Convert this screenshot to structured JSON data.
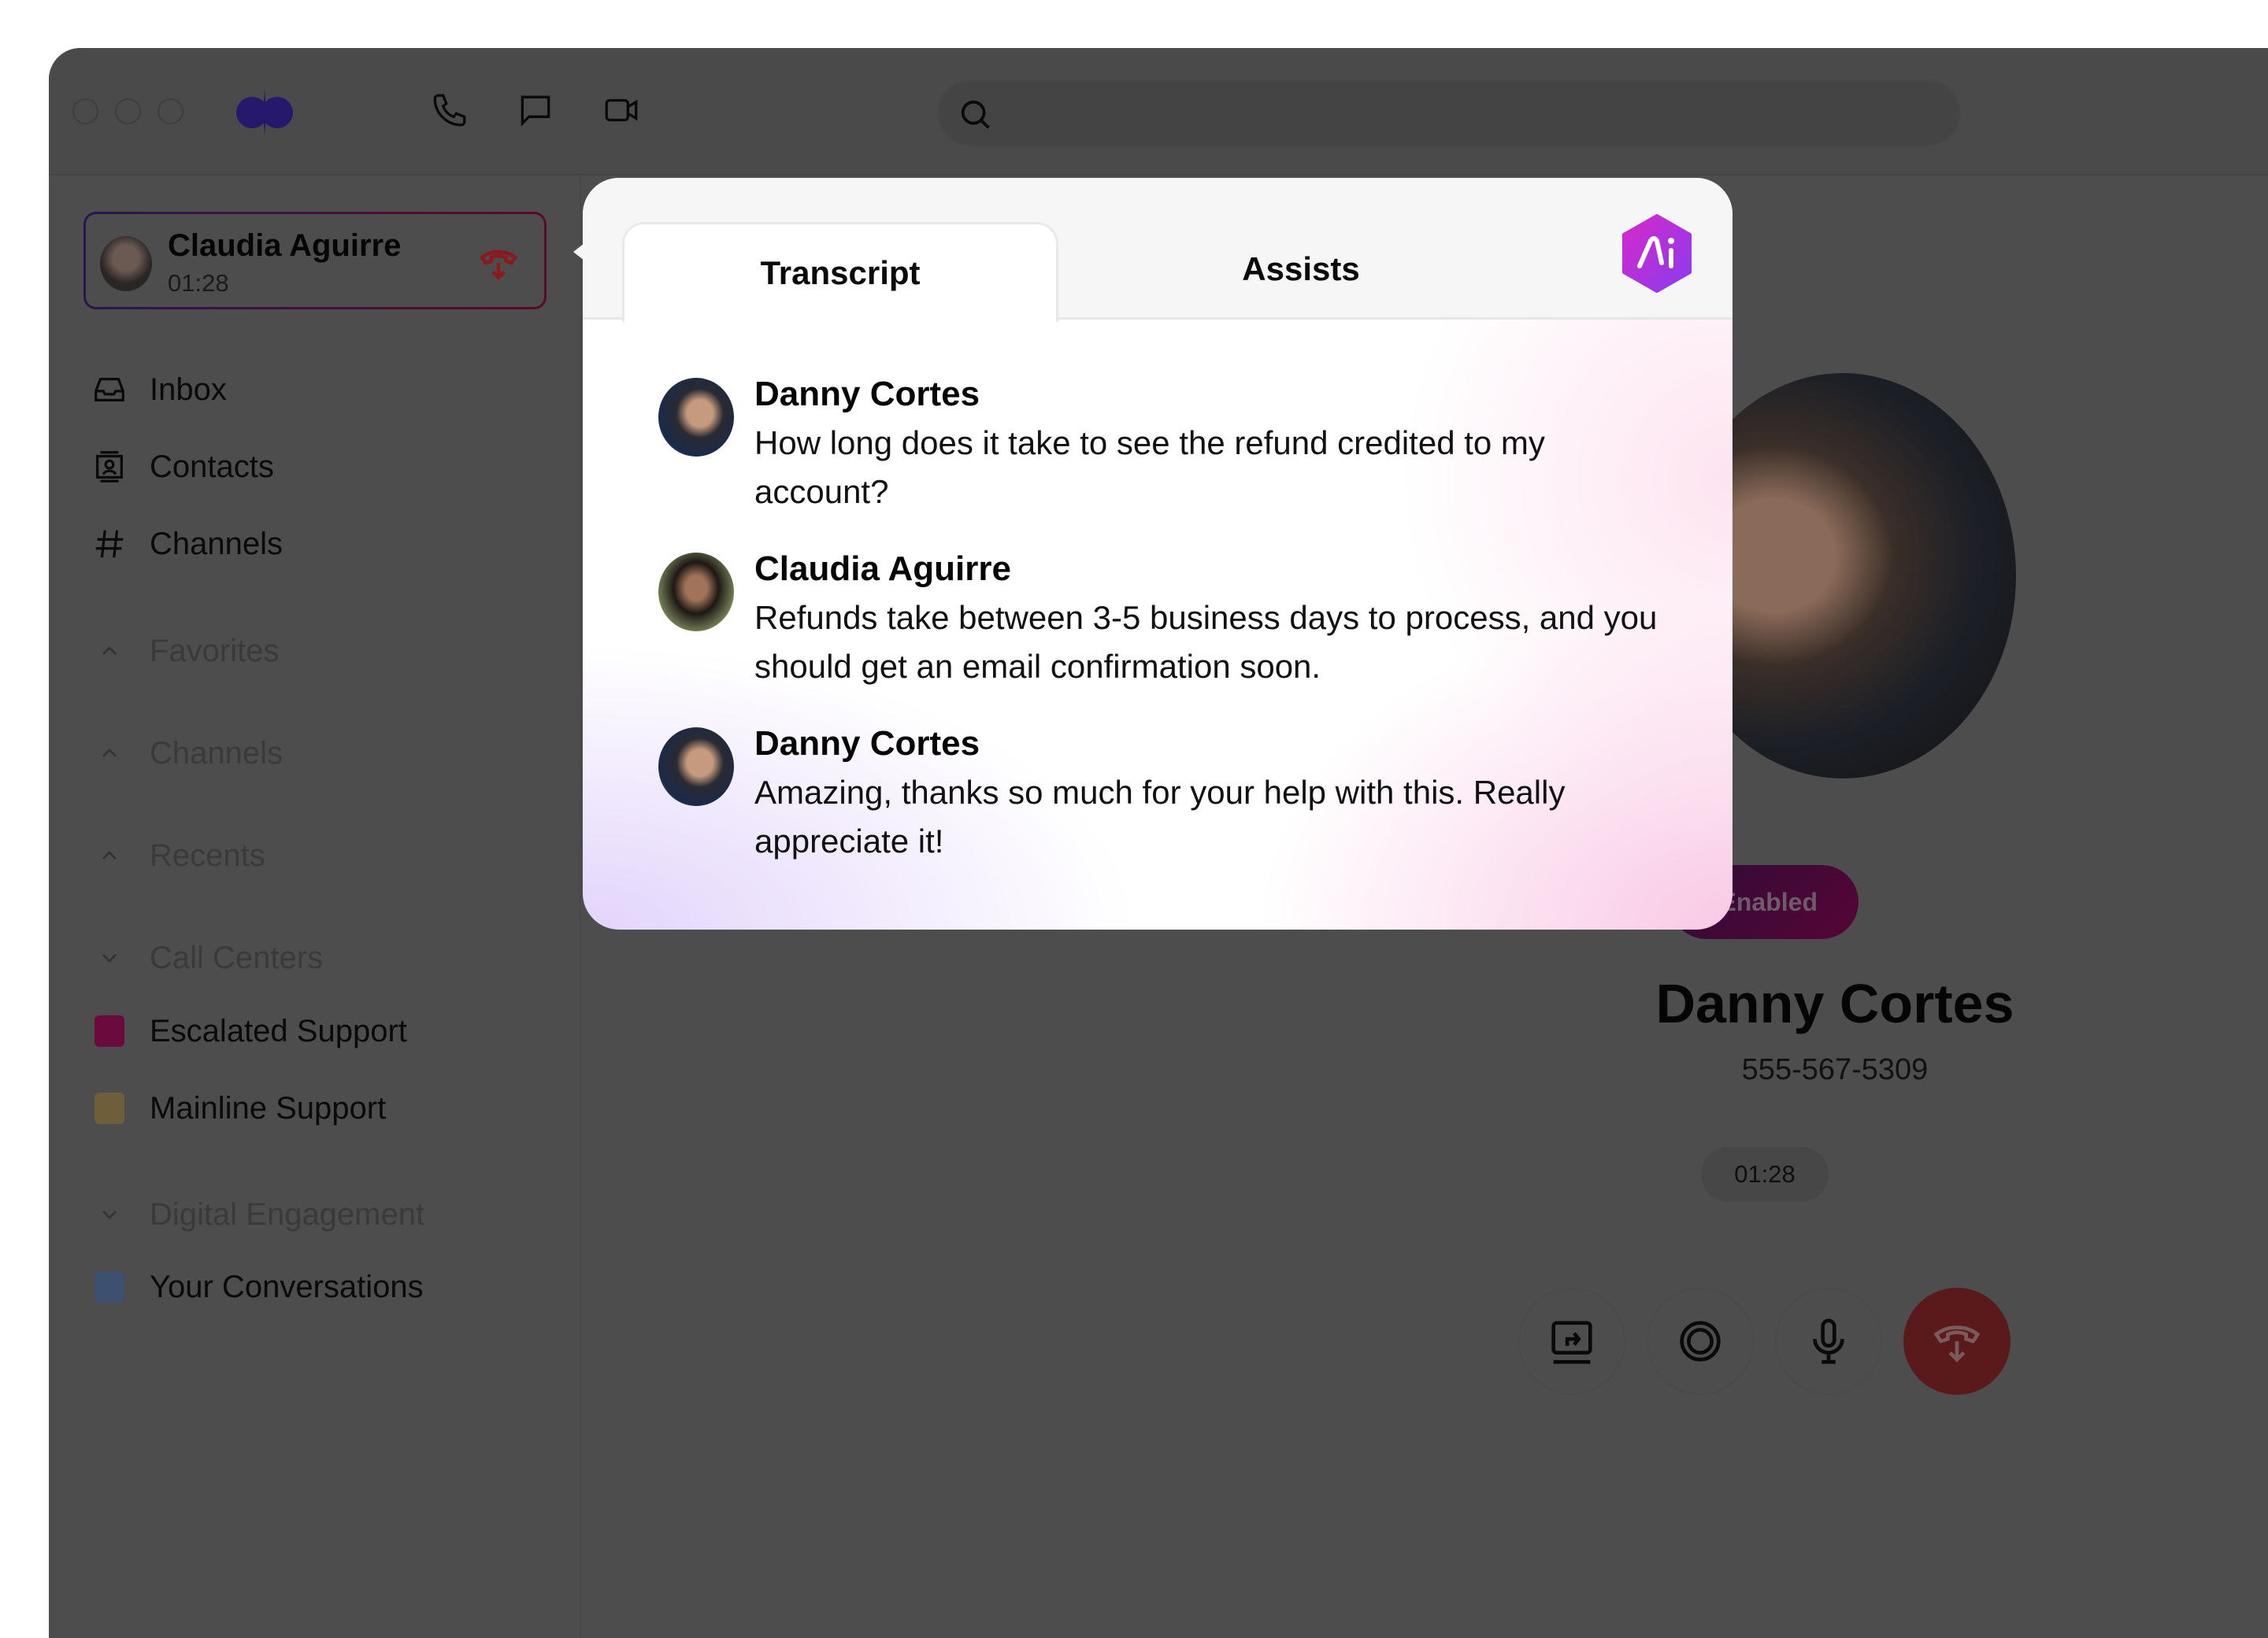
{
  "window": {
    "traffic_lights": [
      "close",
      "minimize",
      "zoom"
    ],
    "logo": "dialpad-logo-icon",
    "toolbar_icons": [
      "phone-icon",
      "message-icon",
      "video-icon"
    ]
  },
  "search": {
    "value": "",
    "placeholder": ""
  },
  "active_call": {
    "name": "Claudia Aguirre",
    "duration": "01:28",
    "hangup_icon": "hangup-icon"
  },
  "sidebar": {
    "nav": [
      {
        "label": "Inbox",
        "icon": "inbox-icon"
      },
      {
        "label": "Contacts",
        "icon": "contacts-icon"
      },
      {
        "label": "Channels",
        "icon": "hash-icon"
      }
    ],
    "sections": [
      {
        "label": "Favorites",
        "state": "collapsed"
      },
      {
        "label": "Channels",
        "state": "collapsed"
      },
      {
        "label": "Recents",
        "state": "collapsed"
      },
      {
        "label": "Call Centers",
        "state": "expanded"
      }
    ],
    "call_centers": [
      {
        "label": "Escalated Support",
        "color": "#6b0a3c"
      },
      {
        "label": "Mainline Support",
        "color": "#6e5e3a"
      }
    ],
    "digital_section": {
      "label": "Digital Engagement",
      "state": "expanded"
    },
    "digital_items": [
      {
        "label": "Your Conversations",
        "color": "#3e5070"
      }
    ]
  },
  "contact": {
    "badge": "Enabled",
    "name": "Danny Cortes",
    "phone": "555-567-5309",
    "timer": "01:28",
    "controls": [
      "transfer-icon",
      "record-icon",
      "microphone-icon",
      "hangup-icon"
    ]
  },
  "popup": {
    "tabs": [
      {
        "label": "Transcript",
        "active": true
      },
      {
        "label": "Assists",
        "active": false
      }
    ],
    "ai_badge": "Ai",
    "messages": [
      {
        "speaker": "Danny Cortes",
        "text": "How long does it take to see the refund credited to my account?"
      },
      {
        "speaker": "Claudia Aguirre",
        "text": "Refunds take between 3-5 business days to process, and you should get an email confirmation soon."
      },
      {
        "speaker": "Danny Cortes",
        "text": "Amazing, thanks so much for your help with this. Really appreciate it!"
      }
    ]
  },
  "colors": {
    "brand": "#2a1a6a",
    "ai_gradient_start": "#d629c8",
    "ai_gradient_end": "#8a3cf0",
    "hangup": "#c0282c",
    "overlay": "#4d4d4d"
  }
}
